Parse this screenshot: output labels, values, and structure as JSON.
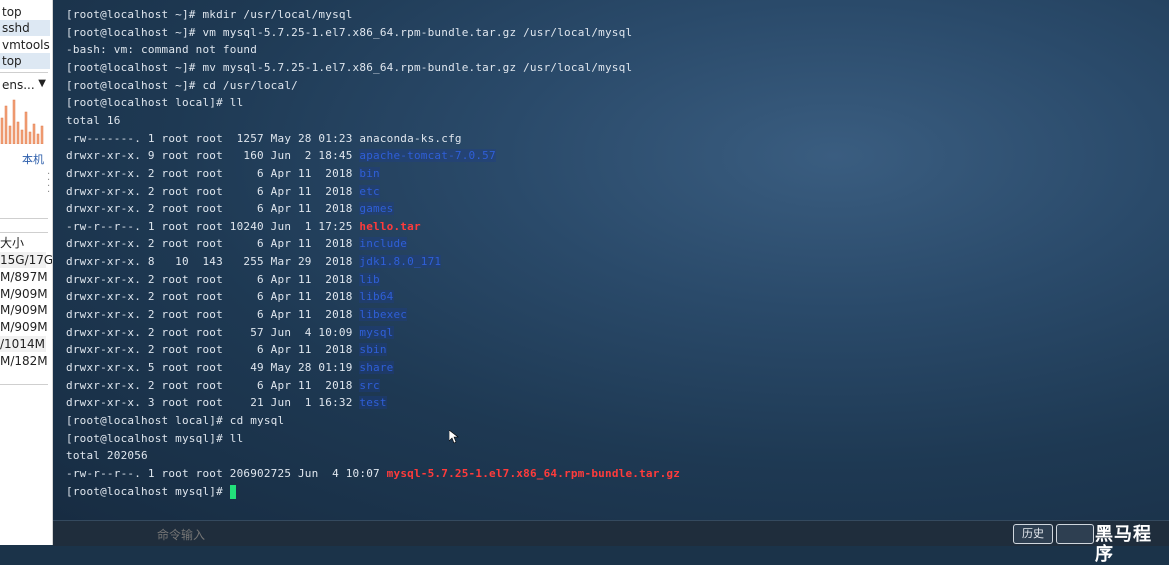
{
  "sidebar": {
    "processes": [
      "top",
      "sshd",
      "vmtools",
      "top"
    ],
    "interface": "ens...",
    "local_label": "本机",
    "size_header": "大小",
    "sizes": [
      "15G/17G",
      "M/897M",
      "M/909M",
      "M/909M",
      "M/909M",
      "/1014M",
      "M/182M"
    ]
  },
  "terminal": {
    "lines": [
      {
        "text": "[root@localhost ~]# mkdir /usr/local/mysql"
      },
      {
        "text": "[root@localhost ~]# vm mysql-5.7.25-1.el7.x86_64.rpm-bundle.tar.gz /usr/local/mysql"
      },
      {
        "text": "-bash: vm: command not found"
      },
      {
        "text": "[root@localhost ~]# mv mysql-5.7.25-1.el7.x86_64.rpm-bundle.tar.gz /usr/local/mysql"
      },
      {
        "text": "[root@localhost ~]# cd /usr/local/"
      },
      {
        "text": "[root@localhost local]# ll"
      },
      {
        "text": "total 16"
      },
      {
        "text": "-rw-------. 1 root root  1257 May 28 01:23 ",
        "name": "anaconda-ks.cfg",
        "type": "file"
      },
      {
        "text": "drwxr-xr-x. 9 root root   160 Jun  2 18:45 ",
        "name": "apache-tomcat-7.0.57",
        "type": "dir"
      },
      {
        "text": "drwxr-xr-x. 2 root root     6 Apr 11  2018 ",
        "name": "bin",
        "type": "dir"
      },
      {
        "text": "drwxr-xr-x. 2 root root     6 Apr 11  2018 ",
        "name": "etc",
        "type": "dir"
      },
      {
        "text": "drwxr-xr-x. 2 root root     6 Apr 11  2018 ",
        "name": "games",
        "type": "dir"
      },
      {
        "text": "-rw-r--r--. 1 root root 10240 Jun  1 17:25 ",
        "name": "hello.tar",
        "type": "archive"
      },
      {
        "text": "drwxr-xr-x. 2 root root     6 Apr 11  2018 ",
        "name": "include",
        "type": "dir"
      },
      {
        "text": "drwxr-xr-x. 8   10  143   255 Mar 29  2018 ",
        "name": "jdk1.8.0_171",
        "type": "dir"
      },
      {
        "text": "drwxr-xr-x. 2 root root     6 Apr 11  2018 ",
        "name": "lib",
        "type": "dir"
      },
      {
        "text": "drwxr-xr-x. 2 root root     6 Apr 11  2018 ",
        "name": "lib64",
        "type": "dir"
      },
      {
        "text": "drwxr-xr-x. 2 root root     6 Apr 11  2018 ",
        "name": "libexec",
        "type": "dir"
      },
      {
        "text": "drwxr-xr-x. 2 root root    57 Jun  4 10:09 ",
        "name": "mysql",
        "type": "dir"
      },
      {
        "text": "drwxr-xr-x. 2 root root     6 Apr 11  2018 ",
        "name": "sbin",
        "type": "dir"
      },
      {
        "text": "drwxr-xr-x. 5 root root    49 May 28 01:19 ",
        "name": "share",
        "type": "dir"
      },
      {
        "text": "drwxr-xr-x. 2 root root     6 Apr 11  2018 ",
        "name": "src",
        "type": "dir"
      },
      {
        "text": "drwxr-xr-x. 3 root root    21 Jun  1 16:32 ",
        "name": "test",
        "type": "dir"
      },
      {
        "text": "[root@localhost local]# cd mysql"
      },
      {
        "text": "[root@localhost mysql]# ll"
      },
      {
        "text": "total 202056"
      },
      {
        "text": "-rw-r--r--. 1 root root 206902725 Jun  4 10:07 ",
        "name": "mysql-5.7.25-1.el7.x86_64.rpm-bundle.tar.gz",
        "type": "archive"
      },
      {
        "text": "[root@localhost mysql]# ",
        "cursor": true
      }
    ]
  },
  "bottombar": {
    "cmd_placeholder": "命令输入",
    "history_label": "历史",
    "watermark": "黑马程序"
  },
  "colors": {
    "dir": "#2f5fd8",
    "archive": "#ff3b3b",
    "cursor": "#22e07a"
  }
}
